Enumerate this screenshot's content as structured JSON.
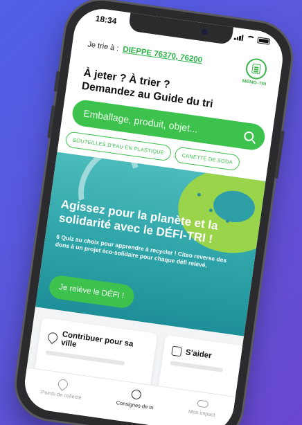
{
  "status": {
    "time": "18:34"
  },
  "header": {
    "trie_label": "Je trie à :",
    "city": "DIEPPE 76370, 76200",
    "memo_label": "MÉMO-TRI"
  },
  "headline": {
    "line1": "À jeter ? À trier ?",
    "line2": "Demandez au Guide du tri"
  },
  "search": {
    "placeholder": "Emballage, produit, objet..."
  },
  "chips": [
    "BOUTEILLES D'EAU EN PLASTIQUE",
    "CANETTE DE SODA"
  ],
  "banner": {
    "title": "Agissez pour la planète et la solidarité avec le DÉFI-TRI !",
    "text": "6 Quiz au choix pour apprendre à recycler ! Citeo reverse des dons à un projet éco-solidaire pour chaque défi relevé.",
    "cta": "Je relève le DÉFI !"
  },
  "cards": [
    {
      "title": "Contribuer pour sa ville",
      "icon": "location-add-icon"
    },
    {
      "title": "S'aider",
      "icon": "document-icon"
    }
  ],
  "tabs": [
    {
      "label": "Points de collecte",
      "icon": "map-pin-icon"
    },
    {
      "label": "Consignes de tri",
      "icon": "search-icon"
    },
    {
      "label": "Mon impact",
      "icon": "cloud-icon"
    }
  ],
  "colors": {
    "accent_green": "#3cc24d",
    "banner_teal": "#2ea4a8",
    "background_blue": "#5b57dc"
  }
}
